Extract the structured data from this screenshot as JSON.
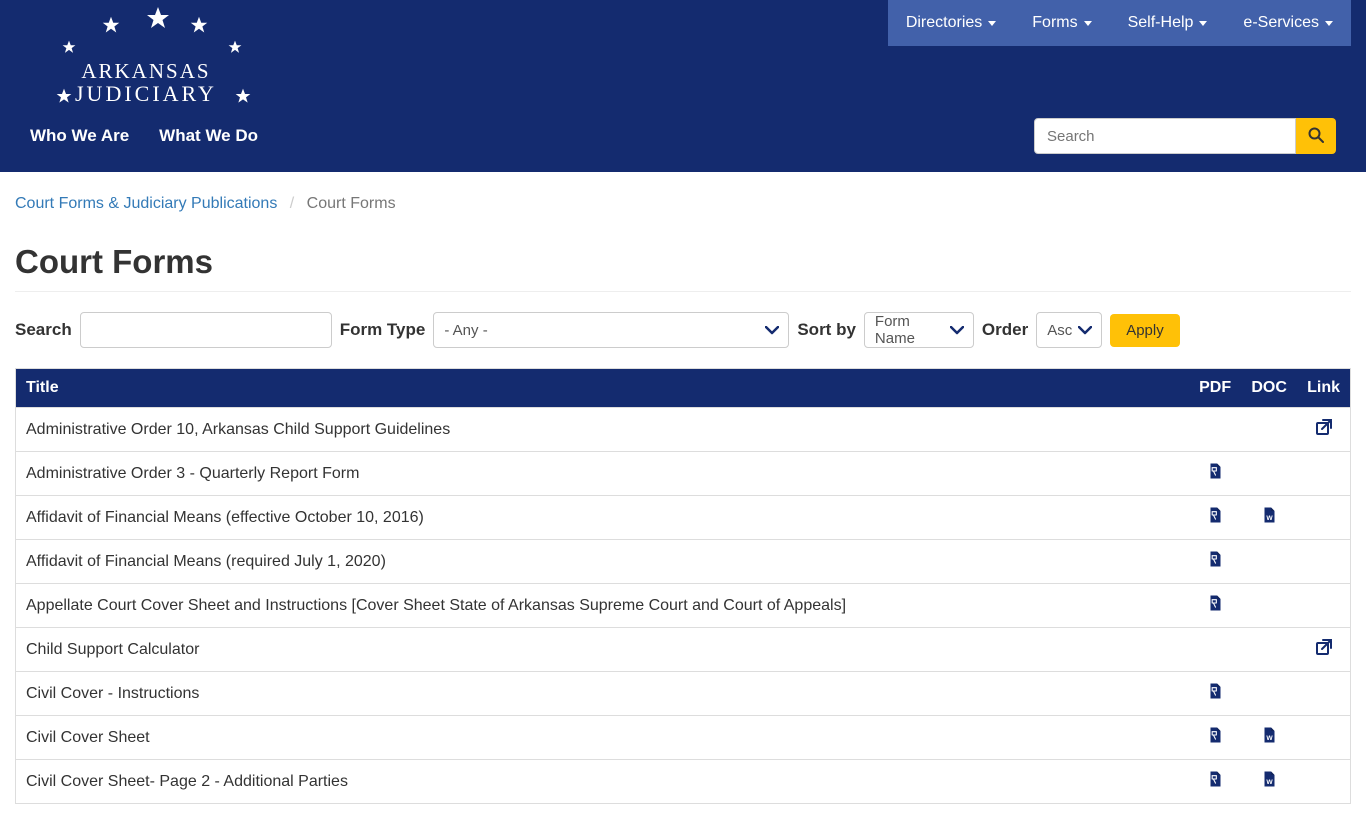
{
  "logo": {
    "line1": "ARKANSAS",
    "line2": "JUDICIARY"
  },
  "topnav": [
    {
      "label": "Directories"
    },
    {
      "label": "Forms"
    },
    {
      "label": "Self-Help"
    },
    {
      "label": "e-Services"
    }
  ],
  "mainnav": [
    {
      "label": "Who We Are"
    },
    {
      "label": "What We Do"
    }
  ],
  "header_search": {
    "placeholder": "Search"
  },
  "breadcrumb": {
    "parent": "Court Forms & Judiciary Publications",
    "current": "Court Forms"
  },
  "page_title": "Court Forms",
  "filters": {
    "search_label": "Search",
    "search_value": "",
    "formtype_label": "Form Type",
    "formtype_value": "- Any -",
    "sortby_label": "Sort by",
    "sortby_value": "Form Name",
    "order_label": "Order",
    "order_value": "Asc",
    "apply_label": "Apply"
  },
  "table": {
    "headers": {
      "title": "Title",
      "pdf": "PDF",
      "doc": "DOC",
      "link": "Link"
    },
    "rows": [
      {
        "title": "Administrative Order 10, Arkansas Child Support Guidelines",
        "pdf": false,
        "doc": false,
        "link": true
      },
      {
        "title": "Administrative Order 3 - Quarterly Report Form",
        "pdf": true,
        "doc": false,
        "link": false
      },
      {
        "title": "Affidavit of Financial Means (effective October 10, 2016)",
        "pdf": true,
        "doc": true,
        "link": false
      },
      {
        "title": "Affidavit of Financial Means (required July 1, 2020)",
        "pdf": true,
        "doc": false,
        "link": false
      },
      {
        "title": "Appellate Court Cover Sheet and Instructions [Cover Sheet State of Arkansas Supreme Court and Court of Appeals]",
        "pdf": true,
        "doc": false,
        "link": false
      },
      {
        "title": "Child Support Calculator",
        "pdf": false,
        "doc": false,
        "link": true
      },
      {
        "title": "Civil Cover - Instructions",
        "pdf": true,
        "doc": false,
        "link": false
      },
      {
        "title": "Civil Cover Sheet",
        "pdf": true,
        "doc": true,
        "link": false
      },
      {
        "title": "Civil Cover Sheet- Page 2 - Additional Parties",
        "pdf": true,
        "doc": true,
        "link": false
      }
    ]
  }
}
